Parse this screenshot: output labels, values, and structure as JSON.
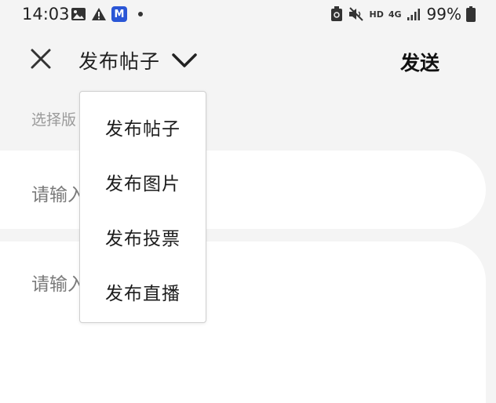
{
  "status_bar": {
    "time": "14:03",
    "left_icons": [
      "image-icon",
      "warning-icon",
      "m-app-icon",
      "dot-icon"
    ],
    "m_badge_text": "M",
    "network_label": "HD",
    "network_type": "4G",
    "battery_percent": "99%"
  },
  "header": {
    "title": "发布帖子",
    "send_label": "发送"
  },
  "section_label": "选择版",
  "inputs": {
    "title_placeholder": "请输入",
    "body_placeholder": "请输入"
  },
  "dropdown": {
    "items": [
      "发布帖子",
      "发布图片",
      "发布投票",
      "发布直播"
    ]
  }
}
